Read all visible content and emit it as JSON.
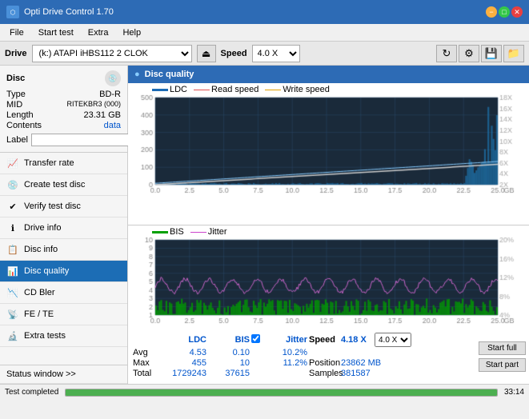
{
  "titlebar": {
    "title": "Opti Drive Control 1.70",
    "icon": "⬡",
    "min": "−",
    "max": "□",
    "close": "✕"
  },
  "menubar": {
    "items": [
      "File",
      "Start test",
      "Extra",
      "Help"
    ]
  },
  "drivebar": {
    "drive_label": "Drive",
    "drive_value": "(k:) ATAPI iHBS112  2 CLOK",
    "speed_label": "Speed",
    "speed_value": "4.0 X",
    "eject_icon": "⏏"
  },
  "disc": {
    "title": "Disc",
    "type_label": "Type",
    "type_value": "BD-R",
    "mid_label": "MID",
    "mid_value": "RITEKBR3 (000)",
    "length_label": "Length",
    "length_value": "23.31 GB",
    "contents_label": "Contents",
    "contents_value": "data",
    "label_label": "Label",
    "label_placeholder": ""
  },
  "nav": {
    "items": [
      {
        "id": "transfer-rate",
        "label": "Transfer rate",
        "icon": "📈"
      },
      {
        "id": "create-test-disc",
        "label": "Create test disc",
        "icon": "💿"
      },
      {
        "id": "verify-test-disc",
        "label": "Verify test disc",
        "icon": "✔"
      },
      {
        "id": "drive-info",
        "label": "Drive info",
        "icon": "ℹ"
      },
      {
        "id": "disc-info",
        "label": "Disc info",
        "icon": "📋"
      },
      {
        "id": "disc-quality",
        "label": "Disc quality",
        "icon": "📊",
        "active": true
      },
      {
        "id": "cd-bler",
        "label": "CD Bler",
        "icon": "📉"
      },
      {
        "id": "fe-te",
        "label": "FE / TE",
        "icon": "📡"
      },
      {
        "id": "extra-tests",
        "label": "Extra tests",
        "icon": "🔬"
      }
    ]
  },
  "quality": {
    "header": "Disc quality",
    "legend": {
      "ldc": "LDC",
      "read_speed": "Read speed",
      "write_speed": "Write speed"
    },
    "legend2": {
      "bis": "BIS",
      "jitter": "Jitter"
    },
    "upper_y_max": 500,
    "upper_y_right_max": 18,
    "lower_y_max": 10,
    "lower_y_right_max": 20,
    "x_max": 25.0,
    "stats": {
      "headers": [
        "",
        "LDC",
        "BIS",
        "",
        "Jitter",
        "Speed"
      ],
      "avg_label": "Avg",
      "avg_ldc": "4.53",
      "avg_bis": "0.10",
      "avg_jitter": "10.2%",
      "avg_speed": "4.18 X",
      "speed_select": "4.0 X",
      "max_label": "Max",
      "max_ldc": "455",
      "max_bis": "10",
      "max_jitter": "11.2%",
      "position_label": "Position",
      "position_val": "23862 MB",
      "total_label": "Total",
      "total_ldc": "1729243",
      "total_bis": "37615",
      "samples_label": "Samples",
      "samples_val": "381587",
      "start_full": "Start full",
      "start_part": "Start part",
      "jitter_checked": true,
      "jitter_label": "Jitter"
    }
  },
  "statusbar": {
    "text": "Test completed",
    "progress": 100,
    "time": "33:14"
  }
}
